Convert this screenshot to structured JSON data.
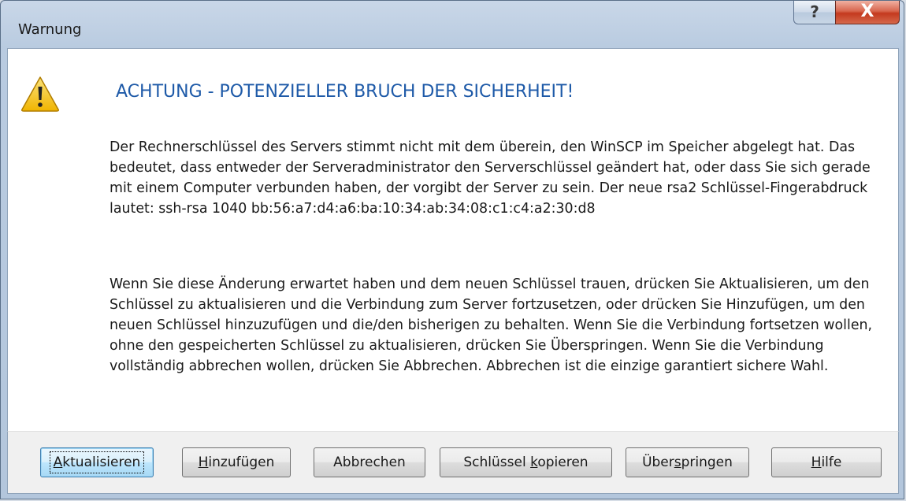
{
  "window": {
    "title": "Warnung",
    "help_glyph": "?",
    "close_glyph": "X"
  },
  "message": {
    "icon": "warning-triangle-icon",
    "heading": "ACHTUNG - POTENZIELLER BRUCH DER SICHERHEIT!",
    "paragraph1": "Der Rechnerschlüssel des Servers stimmt nicht mit dem überein, den WinSCP im Speicher abgelegt hat. Das bedeutet, dass entweder der Serveradministrator den Serverschlüssel geändert hat, oder dass Sie sich gerade mit einem Computer verbunden haben, der vorgibt der Server zu sein. Der neue rsa2 Schlüssel-Fingerabdruck lautet: ssh-rsa 1040 bb:56:a7:d4:a6:ba:10:34:ab:34:08:c1:c4:a2:30:d8",
    "paragraph2": "Wenn Sie diese Änderung erwartet haben und dem neuen Schlüssel trauen, drücken Sie Aktualisieren, um den Schlüssel zu aktualisieren und die Verbindung zum Server fortzusetzen, oder drücken Sie Hinzufügen, um den neuen Schlüssel hinzuzufügen und die/den bisherigen zu behalten. Wenn Sie die Verbindung fortsetzen wollen, ohne den gespeicherten Schlüssel zu aktualisieren, drücken Sie Überspringen. Wenn Sie die Verbindung vollständig abbrechen wollen, drücken Sie Abbrechen. Abbrechen ist die einzige garantiert sichere Wahl."
  },
  "buttons": {
    "update": {
      "pre": "",
      "accel": "A",
      "post": "ktualisieren"
    },
    "add": {
      "pre": "",
      "accel": "H",
      "post": "inzufügen"
    },
    "cancel": {
      "label": "Abbrechen"
    },
    "copy_key": {
      "pre": "Schlüssel ",
      "accel": "k",
      "post": "opieren"
    },
    "skip": {
      "pre": "Über",
      "accel": "s",
      "post": "pringen"
    },
    "help": {
      "pre": "",
      "accel": "H",
      "post": "ilfe"
    }
  },
  "colors": {
    "heading": "#1e5aa8",
    "close_button": "#c4391e",
    "warning_icon": "#f5c518"
  }
}
